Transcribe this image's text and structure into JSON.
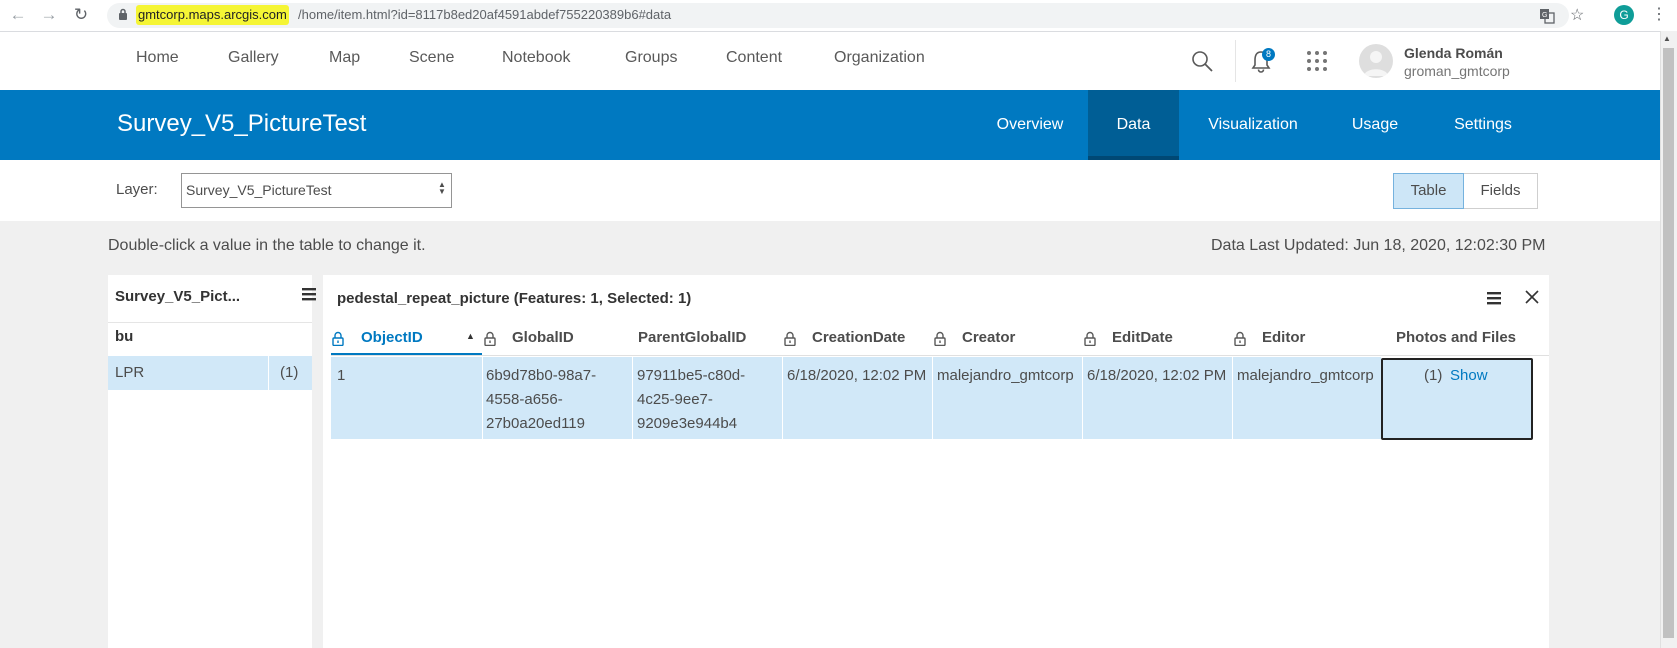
{
  "browser": {
    "url_host": "gmtcorp.maps.arcgis.com",
    "url_path": "/home/item.html?id=8117b8ed20af4591abdef755220389b6#data",
    "profile_initial": "G"
  },
  "nav": {
    "items": [
      "Home",
      "Gallery",
      "Map",
      "Scene",
      "Notebook",
      "Groups",
      "Content",
      "Organization"
    ],
    "notification_count": "8",
    "user_name": "Glenda Román",
    "user_handle": "groman_gmtcorp"
  },
  "item": {
    "title": "Survey_V5_PictureTest",
    "tabs": [
      "Overview",
      "Data",
      "Visualization",
      "Usage",
      "Settings"
    ],
    "active_tab": "Data"
  },
  "layer_bar": {
    "label": "Layer:",
    "selected_layer": "Survey_V5_PictureTest",
    "view_table": "Table",
    "view_fields": "Fields",
    "active_view": "Table"
  },
  "hint": "Double-click a value in the table to change it.",
  "last_updated": "Data Last Updated: Jun 18, 2020, 12:02:30 PM",
  "left_panel": {
    "title": "Survey_V5_Pict...",
    "field": "bu",
    "rows": [
      {
        "label": "LPR",
        "count": "(1)"
      }
    ]
  },
  "table": {
    "title": "pedestal_repeat_picture (Features: 1, Selected: 1)",
    "columns": [
      "ObjectID",
      "GlobalID",
      "ParentGlobalID",
      "CreationDate",
      "Creator",
      "EditDate",
      "Editor",
      "Photos and Files"
    ],
    "sorted_column": "ObjectID",
    "rows": [
      {
        "ObjectID": "1",
        "GlobalID": "6b9d78b0-98a7-4558-a656-27b0a20ed119",
        "ParentGlobalID": "97911be5-c80d-4c25-9ee7-9209e3e944b4",
        "CreationDate": "6/18/2020, 12:02 PM",
        "Creator": "malejandro_gmtcorp",
        "EditDate": "6/18/2020, 12:02 PM",
        "Editor": "malejandro_gmtcorp",
        "photos_count": "(1)",
        "photos_link": "Show"
      }
    ]
  },
  "colors": {
    "brand_blue": "#0079c1",
    "active_tab_bg": "#005e95",
    "selection_blue": "#d1e8f8",
    "url_highlight": "#f5f535"
  }
}
